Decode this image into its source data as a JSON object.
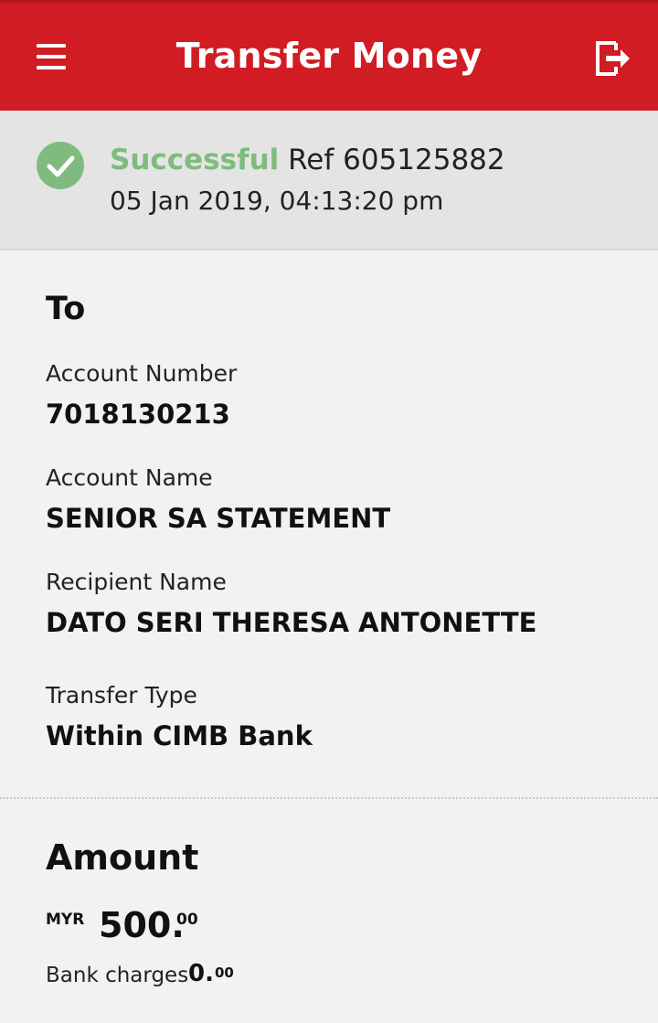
{
  "header": {
    "title": "Transfer Money",
    "menu_icon": "hamburger-menu-icon",
    "logout_icon": "logout-icon",
    "bg_color": "#d11c23"
  },
  "status": {
    "icon": "check-circle-icon",
    "state": "Successful",
    "ref": "Ref 605125882",
    "datetime": "05 Jan 2019, 04:13:20 pm",
    "success_color": "#7fbb7f"
  },
  "to": {
    "title": "To",
    "account_number_label": "Account Number",
    "account_number": "7018130213",
    "account_name_label": "Account Name",
    "account_name": "SENIOR SA STATEMENT",
    "recipient_name_label": "Recipient Name",
    "recipient_name": "DATO SERI THERESA ANTONETTE",
    "transfer_type_label": "Transfer Type",
    "transfer_type": "Within CIMB Bank"
  },
  "amount": {
    "title": "Amount",
    "currency": "MYR",
    "value": "500.",
    "value_decimal": "00",
    "charges_label": "Bank charges",
    "charges_value": "0.",
    "charges_decimal": "00"
  }
}
